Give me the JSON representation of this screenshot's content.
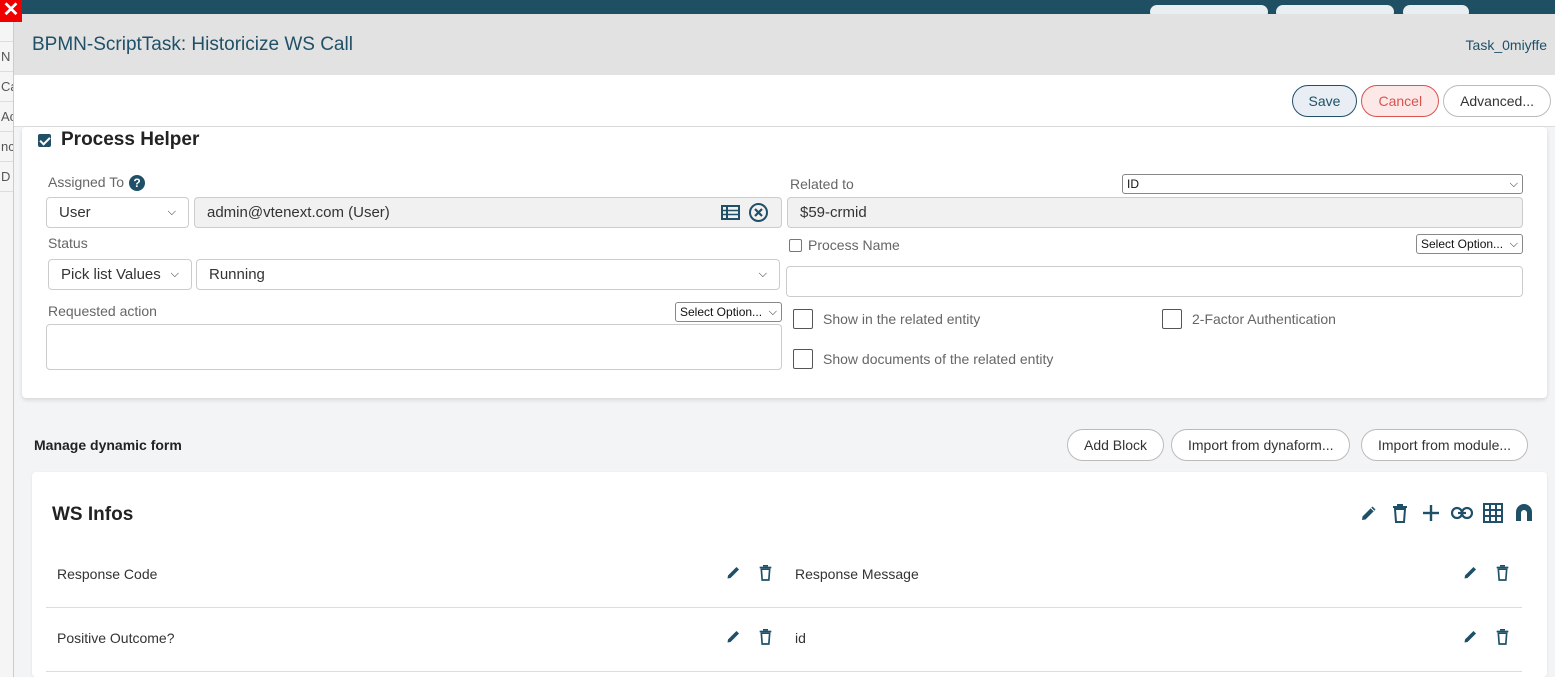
{
  "modal": {
    "title": "BPMN-ScriptTask: Historicize WS Call",
    "task_id": "Task_0miyffe"
  },
  "toolbar": {
    "save_label": "Save",
    "cancel_label": "Cancel",
    "advanced_label": "Advanced..."
  },
  "process_helper": {
    "title": "Process Helper",
    "enabled": true,
    "assigned_to_label": "Assigned To",
    "assigned_type": "User",
    "assigned_value": "admin@vtenext.com (User)",
    "related_to_label": "Related to",
    "related_select": "ID",
    "related_value": "$59-crmid",
    "status_label": "Status",
    "status_type": "Pick list Values",
    "status_value": "Running",
    "process_name_label": "Process Name",
    "process_name_select": "Select Option...",
    "process_name_value": "",
    "requested_action_label": "Requested action",
    "requested_action_select": "Select Option...",
    "requested_action_value": "",
    "show_related_label": "Show in the related entity",
    "two_factor_label": "2-Factor Authentication",
    "show_documents_label": "Show documents of the related entity"
  },
  "manage": {
    "title": "Manage dynamic form",
    "add_block_label": "Add Block",
    "import_dynaform_label": "Import from dynaform...",
    "import_module_label": "Import from module..."
  },
  "ws_block": {
    "title": "WS Infos",
    "fields": [
      {
        "label": "Response Code"
      },
      {
        "label": "Response Message"
      },
      {
        "label": "Positive Outcome?"
      },
      {
        "label": "id"
      }
    ]
  },
  "background": {
    "side_items": [
      "N",
      "Ca",
      "Ac",
      "nc",
      "D"
    ]
  },
  "colors": {
    "accent": "#1f5068",
    "cancel": "#d9534f",
    "header_bg": "#e2e2e2"
  }
}
